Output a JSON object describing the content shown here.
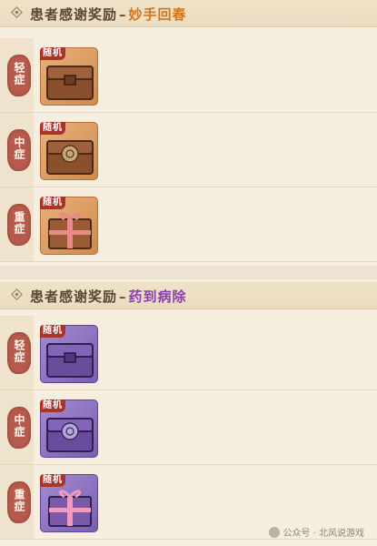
{
  "sections": [
    {
      "title_prefix": "患者感谢奖励",
      "separator": "–",
      "title_suffix": "妙手回春",
      "rows": [
        {
          "severity": "轻症",
          "tag": "随机",
          "item_icon": "wooden-chest-icon",
          "color": "#d08a4e"
        },
        {
          "severity": "中症",
          "tag": "随机",
          "item_icon": "ornate-wooden-chest-icon",
          "color": "#d08a4e"
        },
        {
          "severity": "重症",
          "tag": "随机",
          "item_icon": "gift-box-icon",
          "color": "#d08a4e"
        }
      ]
    },
    {
      "title_prefix": "患者感谢奖励",
      "separator": "–",
      "title_suffix": "药到病除",
      "rows": [
        {
          "severity": "轻症",
          "tag": "随机",
          "item_icon": "purple-chest-icon",
          "color": "#7a5eb2"
        },
        {
          "severity": "中症",
          "tag": "随机",
          "item_icon": "ornate-purple-chest-icon",
          "color": "#7a5eb2"
        },
        {
          "severity": "重症",
          "tag": "随机",
          "item_icon": "purple-gift-box-icon",
          "color": "#7a5eb2"
        }
      ]
    }
  ],
  "watermark": "公众号 · 北风说游戏"
}
